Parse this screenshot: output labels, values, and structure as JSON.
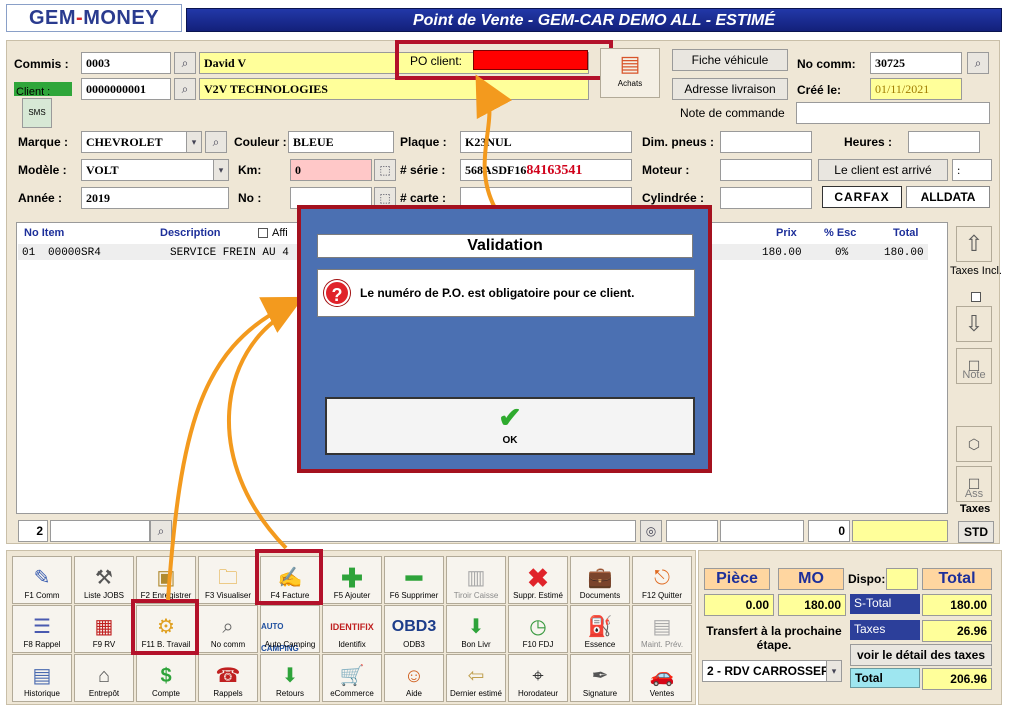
{
  "logo": {
    "left": "GEM",
    "dash": "-",
    "right": "MONEY"
  },
  "window_title": "Point de Vente - GEM-CAR DEMO ALL  - ESTIMÉ",
  "header": {
    "commis_label": "Commis :",
    "commis_value": "0003",
    "commis_name": "David V",
    "client_label": "Client :",
    "client_value": "0000000001",
    "client_name": "V2V TECHNOLOGIES",
    "sms_label": "SMS",
    "po_label": "PO client:",
    "po_value": "",
    "achats_label": "Achats",
    "fiche_vehicule": "Fiche véhicule",
    "adresse_livraison": "Adresse livraison",
    "no_comm_label": "No comm:",
    "no_comm_value": "30725",
    "cree_label": "Créé le:",
    "cree_value": "01/11/2021",
    "note_commande_label": "Note de commande"
  },
  "vehicle": {
    "marque_label": "Marque :",
    "marque_value": "CHEVROLET",
    "modele_label": "Modèle :",
    "modele_value": "VOLT",
    "annee_label": "Année :",
    "annee_value": "2019",
    "couleur_label": "Couleur :",
    "couleur_value": "BLEUE",
    "km_label": "Km:",
    "km_value": "0",
    "no_label": "No :",
    "plaque_label": "Plaque :",
    "plaque_value": "K23NUL",
    "serie_label": "# série :",
    "serie_value_a": "568ASDF16",
    "serie_value_b": "84163541",
    "carte_label": "# carte :",
    "dim_pneus_label": "Dim. pneus :",
    "moteur_label": "Moteur :",
    "cylindree_label": "Cylindrée :",
    "heures_label": "Heures :",
    "client_arrive": "Le client est arrivé",
    "client_arrive_value": ":",
    "carfax": "CARFAX",
    "alldata": "ALLDATA"
  },
  "grid": {
    "headers": {
      "no_item": "No Item",
      "description": "Description",
      "affi": "Affi",
      "prix": "Prix",
      "esc": "% Esc",
      "total": "Total"
    },
    "rows": [
      {
        "no": "01",
        "code": "00000SR4",
        "description": "SERVICE FREIN AU 4",
        "prix": "180.00",
        "esc": "0%",
        "total": "180.00"
      }
    ],
    "bottom_qty": "2",
    "bottom_value": "0"
  },
  "side": {
    "taxes_incl": "Taxes Incl.",
    "note": "Note",
    "ass": "Ass",
    "taxes": "Taxes",
    "std": "STD"
  },
  "dialog": {
    "title": "Validation",
    "message": "Le numéro de P.O. est obligatoire pour ce client.",
    "ok": "OK"
  },
  "toolbar": {
    "row1": [
      "F1 Comm",
      "Liste JOBS",
      "F2 Enregistrer",
      "F3 Visualiser",
      "F4 Facture",
      "F5 Ajouter",
      "F6 Supprimer",
      "Tiroir Caisse",
      "Suppr. Estimé",
      "Documents",
      "F12 Quitter"
    ],
    "row2": [
      "F8 Rappel",
      "F9 RV",
      "F11 B. Travail",
      "No comm",
      "Auto Camping",
      "Identifix",
      "ODB3",
      "Bon Livr",
      "F10 FDJ",
      "Essence",
      "Maint. Prév."
    ],
    "row3": [
      "Historique",
      "Entrepôt",
      "Compte",
      "Rappels",
      "Retours",
      "eCommerce",
      "Aide",
      "Dernier estimé",
      "Horodateur",
      "Signature",
      "Ventes"
    ],
    "brand_auto": "AUTO CAMPING",
    "brand_identifix": "IDENTIFIX",
    "brand_obd3": "OBD3"
  },
  "totals": {
    "piece_label": "Pièce",
    "mo_label": "MO",
    "dispo_label": "Dispo:",
    "total_label": "Total",
    "piece_value": "0.00",
    "mo_value": "180.00",
    "stotal_label": "S-Total",
    "stotal_value": "180.00",
    "taxes_label": "Taxes",
    "taxes_value": "26.96",
    "total_final_label": "Total",
    "total_final_value": "206.96",
    "transfert": "Transfert à la prochaine étape.",
    "stage_value": "2 - RDV CARROSSEF",
    "detail_taxes": "voir le détail des taxes"
  },
  "colors": {
    "title_bar": "#1a2a95",
    "panel": "#efe7d6",
    "dialog_bg": "#4b70b2",
    "highlight_red": "#b3112a",
    "arrow_orange": "#f39a1e",
    "yellow_field": "#ffff9a",
    "po_field": "#ff0000"
  }
}
